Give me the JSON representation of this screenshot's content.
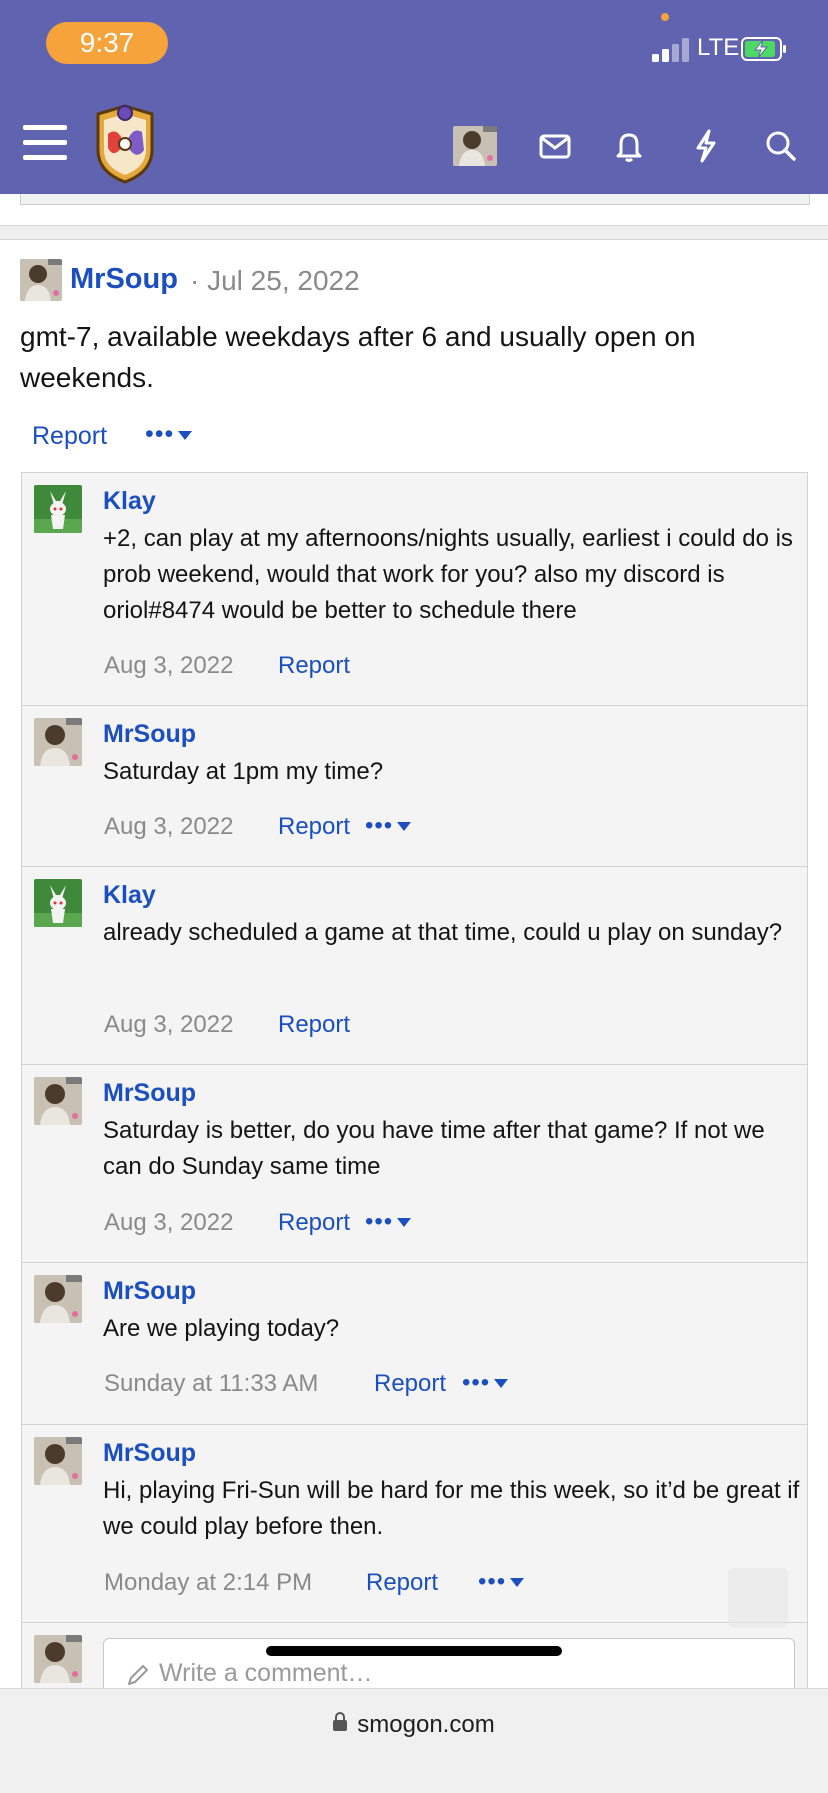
{
  "status_bar": {
    "time": "9:37",
    "network": "LTE"
  },
  "nav": {
    "icons": [
      "menu-icon",
      "site-logo",
      "user-avatar",
      "inbox-icon",
      "bell-icon",
      "lightning-icon",
      "search-icon"
    ],
    "accent": "#6063b0"
  },
  "post": {
    "username": "MrSoup",
    "date": "· Jul 25, 2022",
    "body": "gmt-7, available weekdays after 6 and usually open on weekends.",
    "report": "Report",
    "more": "•••"
  },
  "comments": [
    {
      "username": "Klay",
      "body": "+2, can play at my afternoons/nights usually, earliest i could do is prob weekend, would that work for you? also my discord is oriol#8474 would be better to schedule there",
      "date": "Aug 3, 2022",
      "report": "Report",
      "more": ""
    },
    {
      "username": "MrSoup",
      "body": "Saturday at 1pm my time?",
      "date": "Aug 3, 2022",
      "report": "Report",
      "more": "•••"
    },
    {
      "username": "Klay",
      "body": "already scheduled a game at that time, could u play on sunday?",
      "date": "Aug 3, 2022",
      "report": "Report",
      "more": ""
    },
    {
      "username": "MrSoup",
      "body": "Saturday is better, do you have time after that game? If not we can do Sunday same time",
      "date": "Aug 3, 2022",
      "report": "Report",
      "more": "•••"
    },
    {
      "username": "MrSoup",
      "body": "Are we playing today?",
      "date": "Sunday at 11:33 AM",
      "report": "Report",
      "more": "•••"
    },
    {
      "username": "MrSoup",
      "body": "Hi, playing Fri-Sun will be hard for me this week, so it’d be great if we could play before then.",
      "date": "Monday at 2:14 PM",
      "report": "Report",
      "more": "•••"
    }
  ],
  "comment_input": {
    "placeholder": "Write a comment…"
  },
  "browser": {
    "domain": "smogon.com"
  }
}
